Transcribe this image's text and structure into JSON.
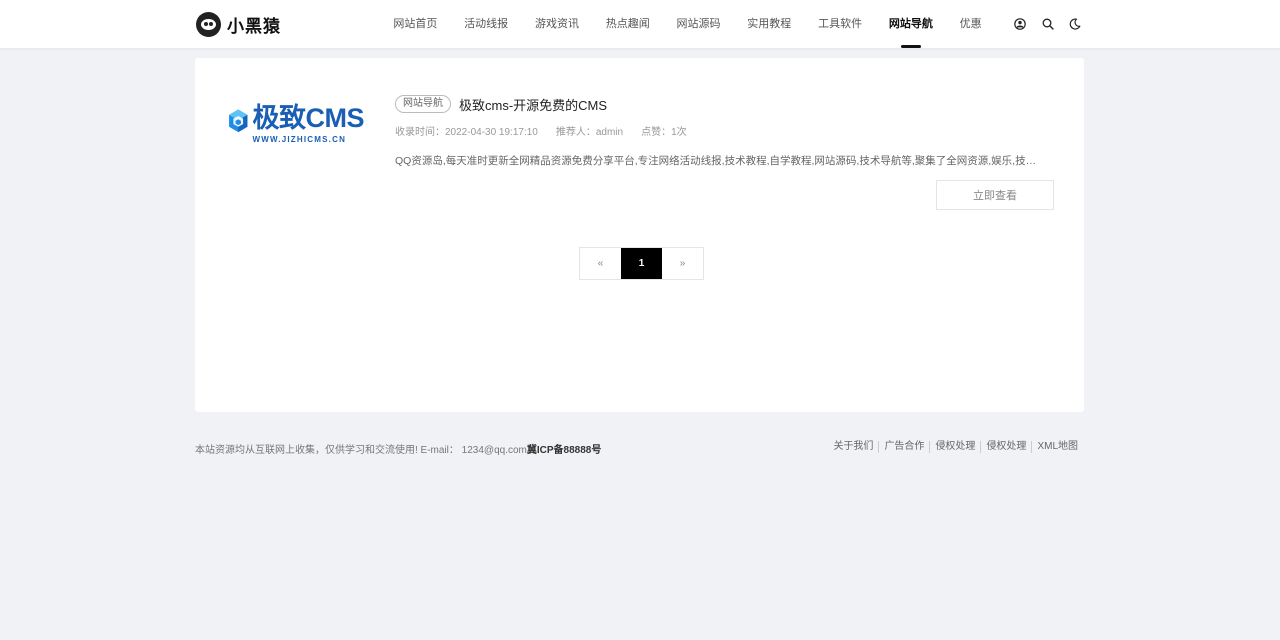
{
  "brand": {
    "name": "小黑猿"
  },
  "nav": {
    "items": [
      {
        "label": "网站首页"
      },
      {
        "label": "活动线报"
      },
      {
        "label": "游戏资讯"
      },
      {
        "label": "热点趣闻"
      },
      {
        "label": "网站源码"
      },
      {
        "label": "实用教程"
      },
      {
        "label": "工具软件"
      },
      {
        "label": "网站导航",
        "active": true
      },
      {
        "label": "优惠"
      }
    ]
  },
  "tools": {
    "icons": [
      "user-icon",
      "search-icon",
      "moon-icon"
    ]
  },
  "item": {
    "thumb_title": "极致CMS",
    "thumb_sub": "WWW.JIZHICMS.CN",
    "tag": "网站导航",
    "title": "极致cms-开源免费的CMS",
    "date": "收录时间：2022-04-30 19:17:10",
    "author": "推荐人：admin",
    "likes": "点赞：1次",
    "description": "QQ资源岛,每天准时更新全网精品资源免费分享平台,专注网络活动线报,技术教程,自学教程,网站源码,技术导航等,聚集了全网资源,娱乐,技术,教程,游戏资讯等",
    "button": "立即查看"
  },
  "pagination": {
    "prev": "«",
    "current": "1",
    "next": "»"
  },
  "footer": {
    "notice": "本站资源均从互联网上收集，仅供学习和交流使用! E-mail： 1234@qq.com",
    "icp": "冀ICP备88888号",
    "links": [
      "关于我们",
      "广告合作",
      "侵权处理",
      "侵权处理",
      "XML地图"
    ]
  },
  "colors": {
    "accent": "#000000",
    "brand_blue": "#1a5fb4",
    "background": "#f0f2f5"
  }
}
